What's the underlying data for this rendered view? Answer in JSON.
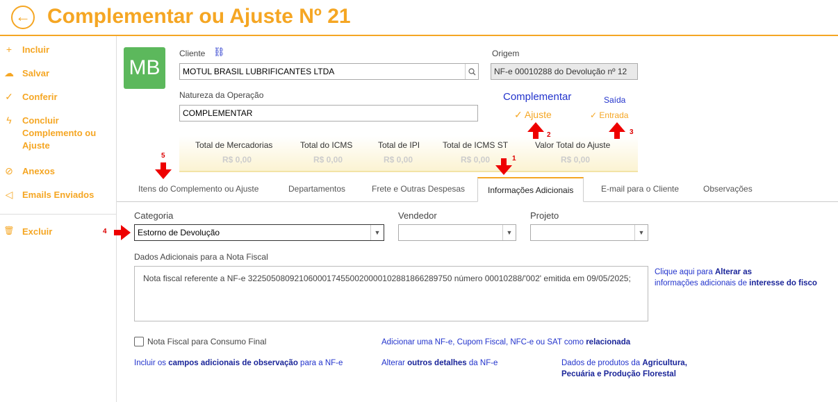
{
  "header": {
    "title": "Complementar ou Ajuste Nº 21"
  },
  "sidebar": {
    "items": [
      {
        "label": "Incluir",
        "icon": "plus-icon",
        "glyph": "+"
      },
      {
        "label": "Salvar",
        "icon": "cloud-icon",
        "glyph": "☁"
      },
      {
        "label": "Conferir",
        "icon": "check-icon",
        "glyph": "✓"
      },
      {
        "label": "Concluir Complemento ou Ajuste",
        "icon": "lightning-icon",
        "glyph": "ϟ"
      },
      {
        "label": "Anexos",
        "icon": "paperclip-icon",
        "glyph": "⊘"
      },
      {
        "label": "Emails Enviados",
        "icon": "paper-plane-icon",
        "glyph": "◁"
      },
      {
        "label": "Excluir",
        "icon": "trash-icon",
        "glyph": "🗑"
      }
    ]
  },
  "avatar": {
    "initials": "MB",
    "color": "#5cb85c"
  },
  "cliente": {
    "label": "Cliente",
    "value": "MOTUL BRASIL LUBRIFICANTES LTDA"
  },
  "origem": {
    "label": "Origem",
    "value": "NF-e 00010288 do Devolução nº 12"
  },
  "natureza": {
    "label": "Natureza da Operação",
    "value": "COMPLEMENTAR"
  },
  "tipo": {
    "complementar": "Complementar",
    "ajuste": "Ajuste"
  },
  "direcao": {
    "saida": "Saída",
    "entrada": "Entrada"
  },
  "totals": [
    {
      "label": "Total de Mercadorias",
      "value": "R$ 0,00"
    },
    {
      "label": "Total do ICMS",
      "value": "R$ 0,00"
    },
    {
      "label": "Total de IPI",
      "value": "R$ 0,00"
    },
    {
      "label": "Total de ICMS ST",
      "value": "R$ 0,00"
    },
    {
      "label": "Valor Total do Ajuste",
      "value": "R$ 0,00"
    }
  ],
  "tabs": [
    "Itens do Complemento ou Ajuste",
    "Departamentos",
    "Frete e Outras Despesas",
    "Informações Adicionais",
    "E-mail para o Cliente",
    "Observações"
  ],
  "categoria": {
    "label": "Categoria",
    "value": "Estorno de  Devolução"
  },
  "vendedor": {
    "label": "Vendedor",
    "value": ""
  },
  "projeto": {
    "label": "Projeto",
    "value": ""
  },
  "dados": {
    "label": "Dados Adicionais para a Nota Fiscal",
    "text": "Nota fiscal referente a NF-e 32250508092106000174550020000102881866289750 número 00010288/'002' emitida em 09/05/2025;"
  },
  "links": {
    "alterar_pre": "Clique aqui para ",
    "alterar_b1": "Alterar as",
    "alterar_mid": "informações adicionais de ",
    "alterar_b2": "interesse do fisco",
    "adicionar_pre": "Adicionar uma NF-e, Cupom Fiscal, NFC-e ou SAT como ",
    "adicionar_b": "relacionada",
    "incluir_pre": "Incluir os ",
    "incluir_b": "campos adicionais de observação",
    "incluir_post": " para a NF-e",
    "outros_pre": "Alterar ",
    "outros_b": "outros detalhes",
    "outros_post": " da NF-e",
    "agri_pre": "Dados de produtos da ",
    "agri_b1": "Agricultura,",
    "agri_b2": "Pecuária e Produção Florestal"
  },
  "consumo_final": {
    "label": "Nota Fiscal para Consumo Final",
    "checked": false
  },
  "markers": [
    "1",
    "2",
    "3",
    "4",
    "5"
  ],
  "colors": {
    "accent": "#f5a623",
    "link": "#2233cc",
    "annotation": "#e00000"
  }
}
